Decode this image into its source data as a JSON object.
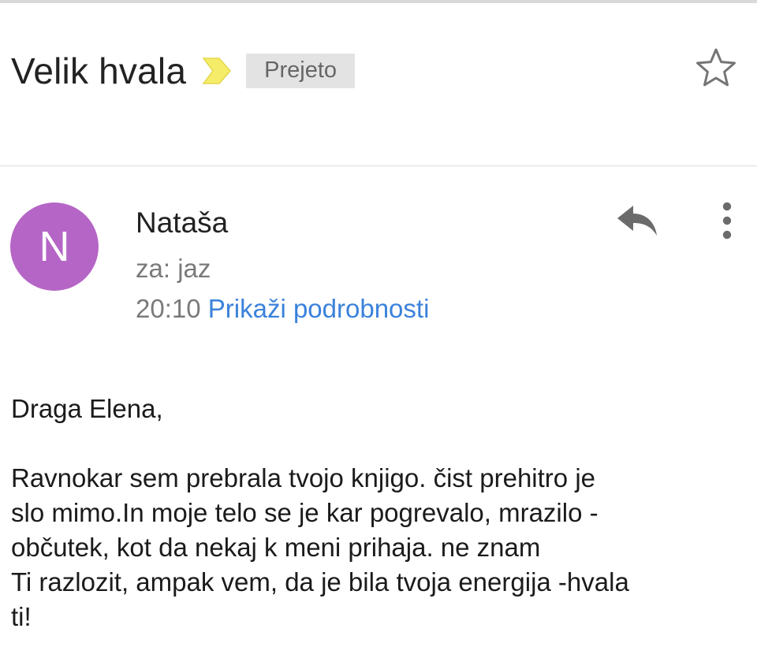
{
  "message": {
    "subject": "Velik hvala",
    "label": "Prejeto",
    "sender": {
      "initial": "N",
      "name": "Nataša",
      "avatar_color": "#b565c6"
    },
    "recipient_line": "za: jaz",
    "time": "20:10",
    "details_link": "Prikaži podrobnosti",
    "body": {
      "greeting": "Draga Elena,",
      "lines": [
        "Ravnokar sem prebrala tvojo knjigo. čist prehitro je",
        "slo mimo.In moje telo se je kar pogrevalo, mrazilo -",
        "občutek, kot da nekaj k meni prihaja. ne znam",
        "Ti razlozit, ampak vem, da je bila tvoja energija -hvala",
        "ti!"
      ]
    }
  },
  "icons": {
    "importance": "importance-marker-icon",
    "star": "star-outline-icon",
    "reply": "reply-icon",
    "more": "more-vert-icon"
  },
  "colors": {
    "link": "#3b82db",
    "importance_marker": "#f5ec6a",
    "label_background": "#e3e3e3"
  }
}
